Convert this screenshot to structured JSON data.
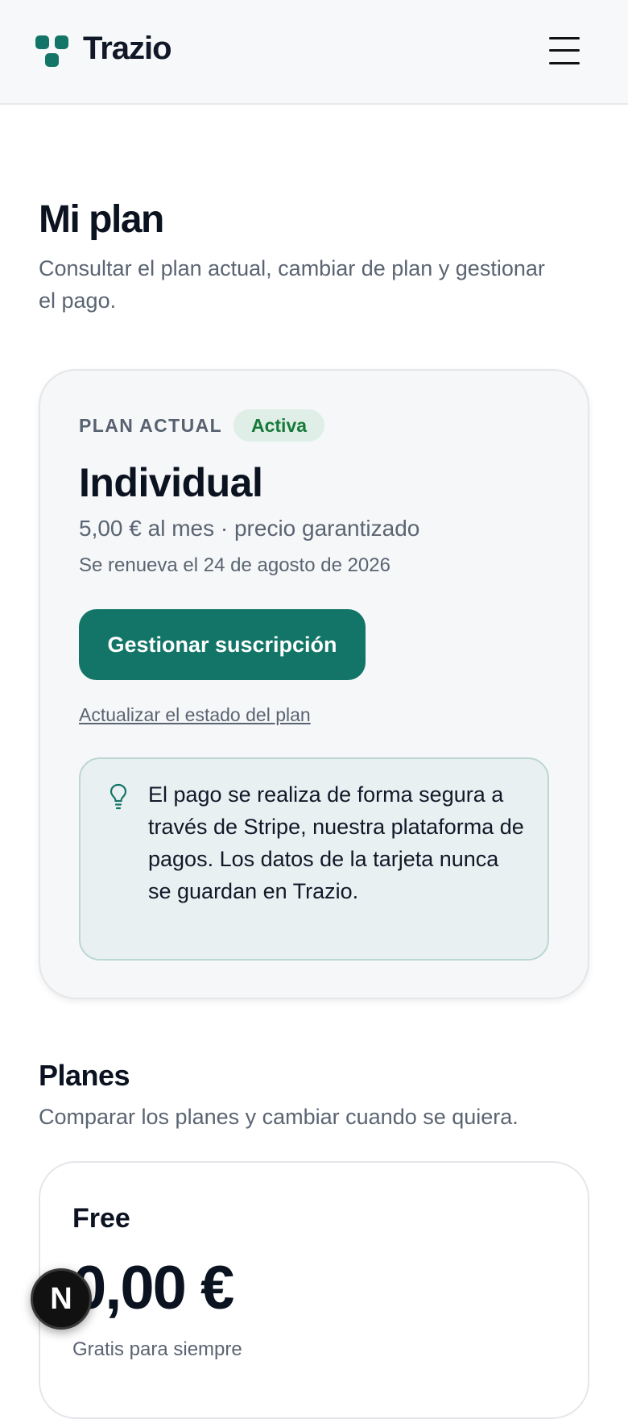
{
  "header": {
    "brand": "Trazio",
    "menu_icon": "hamburger-menu-icon"
  },
  "page": {
    "title": "Mi plan",
    "subtitle": "Consultar el plan actual, cambiar de plan y gestionar el pago."
  },
  "current_plan": {
    "label": "PLAN ACTUAL",
    "status": "Activa",
    "name": "Individual",
    "price": "5,00 € al mes · precio garantizado",
    "renewal": "Se renueva el 24 de agosto de 2026",
    "manage_button": "Gestionar suscripción",
    "refresh_link": "Actualizar el estado del plan",
    "info_icon": "lightbulb-icon",
    "info_text": "El pago se realiza de forma segura a través de Stripe, nuestra plataforma de pagos. Los datos de la tarjeta nunca se guardan en Trazio."
  },
  "plans_section": {
    "title": "Planes",
    "subtitle": "Comparar los planes y cambiar cuando se quiera.",
    "plans": [
      {
        "name": "Free",
        "price": "0,00 €",
        "note": "Gratis para siempre"
      }
    ]
  },
  "dev_badge": {
    "letter": "N",
    "icon": "nextjs-dev-icon"
  },
  "colors": {
    "brand": "#127567",
    "active_badge_bg": "#dfeee6",
    "active_badge_text": "#177a3a",
    "info_bg": "#e9f0f2"
  }
}
